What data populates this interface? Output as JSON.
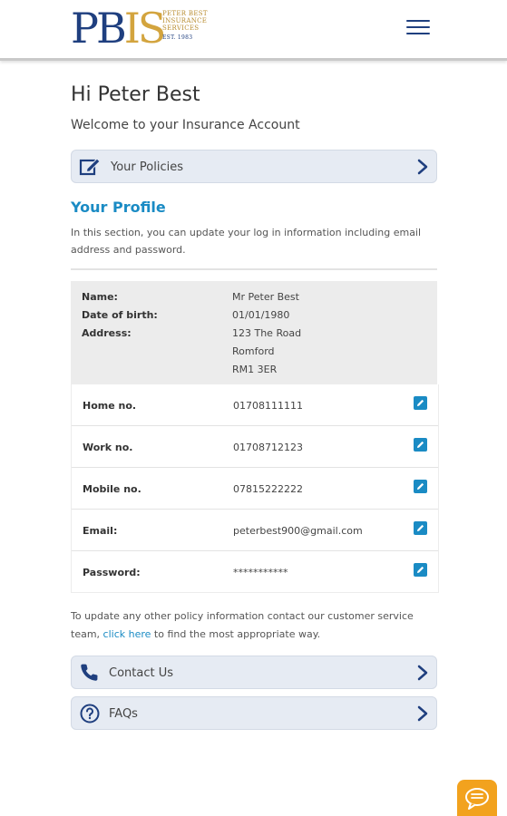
{
  "header": {
    "logo_mark_a": "PB",
    "logo_mark_b": "IS",
    "logo_line1": "PETER BEST",
    "logo_line2": "INSURANCE",
    "logo_line3": "SERVICES",
    "logo_est": "EST. 1983",
    "menu_icon": "hamburger-menu-icon"
  },
  "greeting": "Hi Peter Best",
  "welcome": "Welcome to your Insurance Account",
  "policies_nav": {
    "label": "Your Policies",
    "icon": "edit-document-icon"
  },
  "profile": {
    "title": "Your Profile",
    "description": "In this section, you can update your log in information including email address and password.",
    "name_label": "Name:",
    "name": "Mr Peter Best",
    "dob_label": "Date of birth:",
    "dob": "01/01/1980",
    "address_label": "Address:",
    "address_line1": "123 The Road",
    "address_line2": "Romford",
    "address_line3": "RM1 3ER",
    "rows": [
      {
        "label": "Home no.",
        "value": "01708111111"
      },
      {
        "label": "Work no.",
        "value": "01708712123"
      },
      {
        "label": "Mobile no.",
        "value": "07815222222"
      },
      {
        "label": "Email:",
        "value": "peterbest900@gmail.com"
      },
      {
        "label": "Password:",
        "value": "***********"
      }
    ]
  },
  "footer_note": {
    "before": "To update any other policy information contact our customer service team, ",
    "link": "click here",
    "after": " to find the most appropriate way."
  },
  "contact_nav": {
    "label": "Contact Us",
    "icon": "phone-icon"
  },
  "faq_nav": {
    "label": "FAQs",
    "icon": "question-circle-icon"
  },
  "chat": {
    "icon": "chat-bubble-icon"
  },
  "colors": {
    "brand_blue": "#1f3f7f",
    "brand_gold": "#d3a43e",
    "accent": "#1a8bc4",
    "nav_bg": "#e6ebf3",
    "chat_orange": "#f2a21e"
  }
}
